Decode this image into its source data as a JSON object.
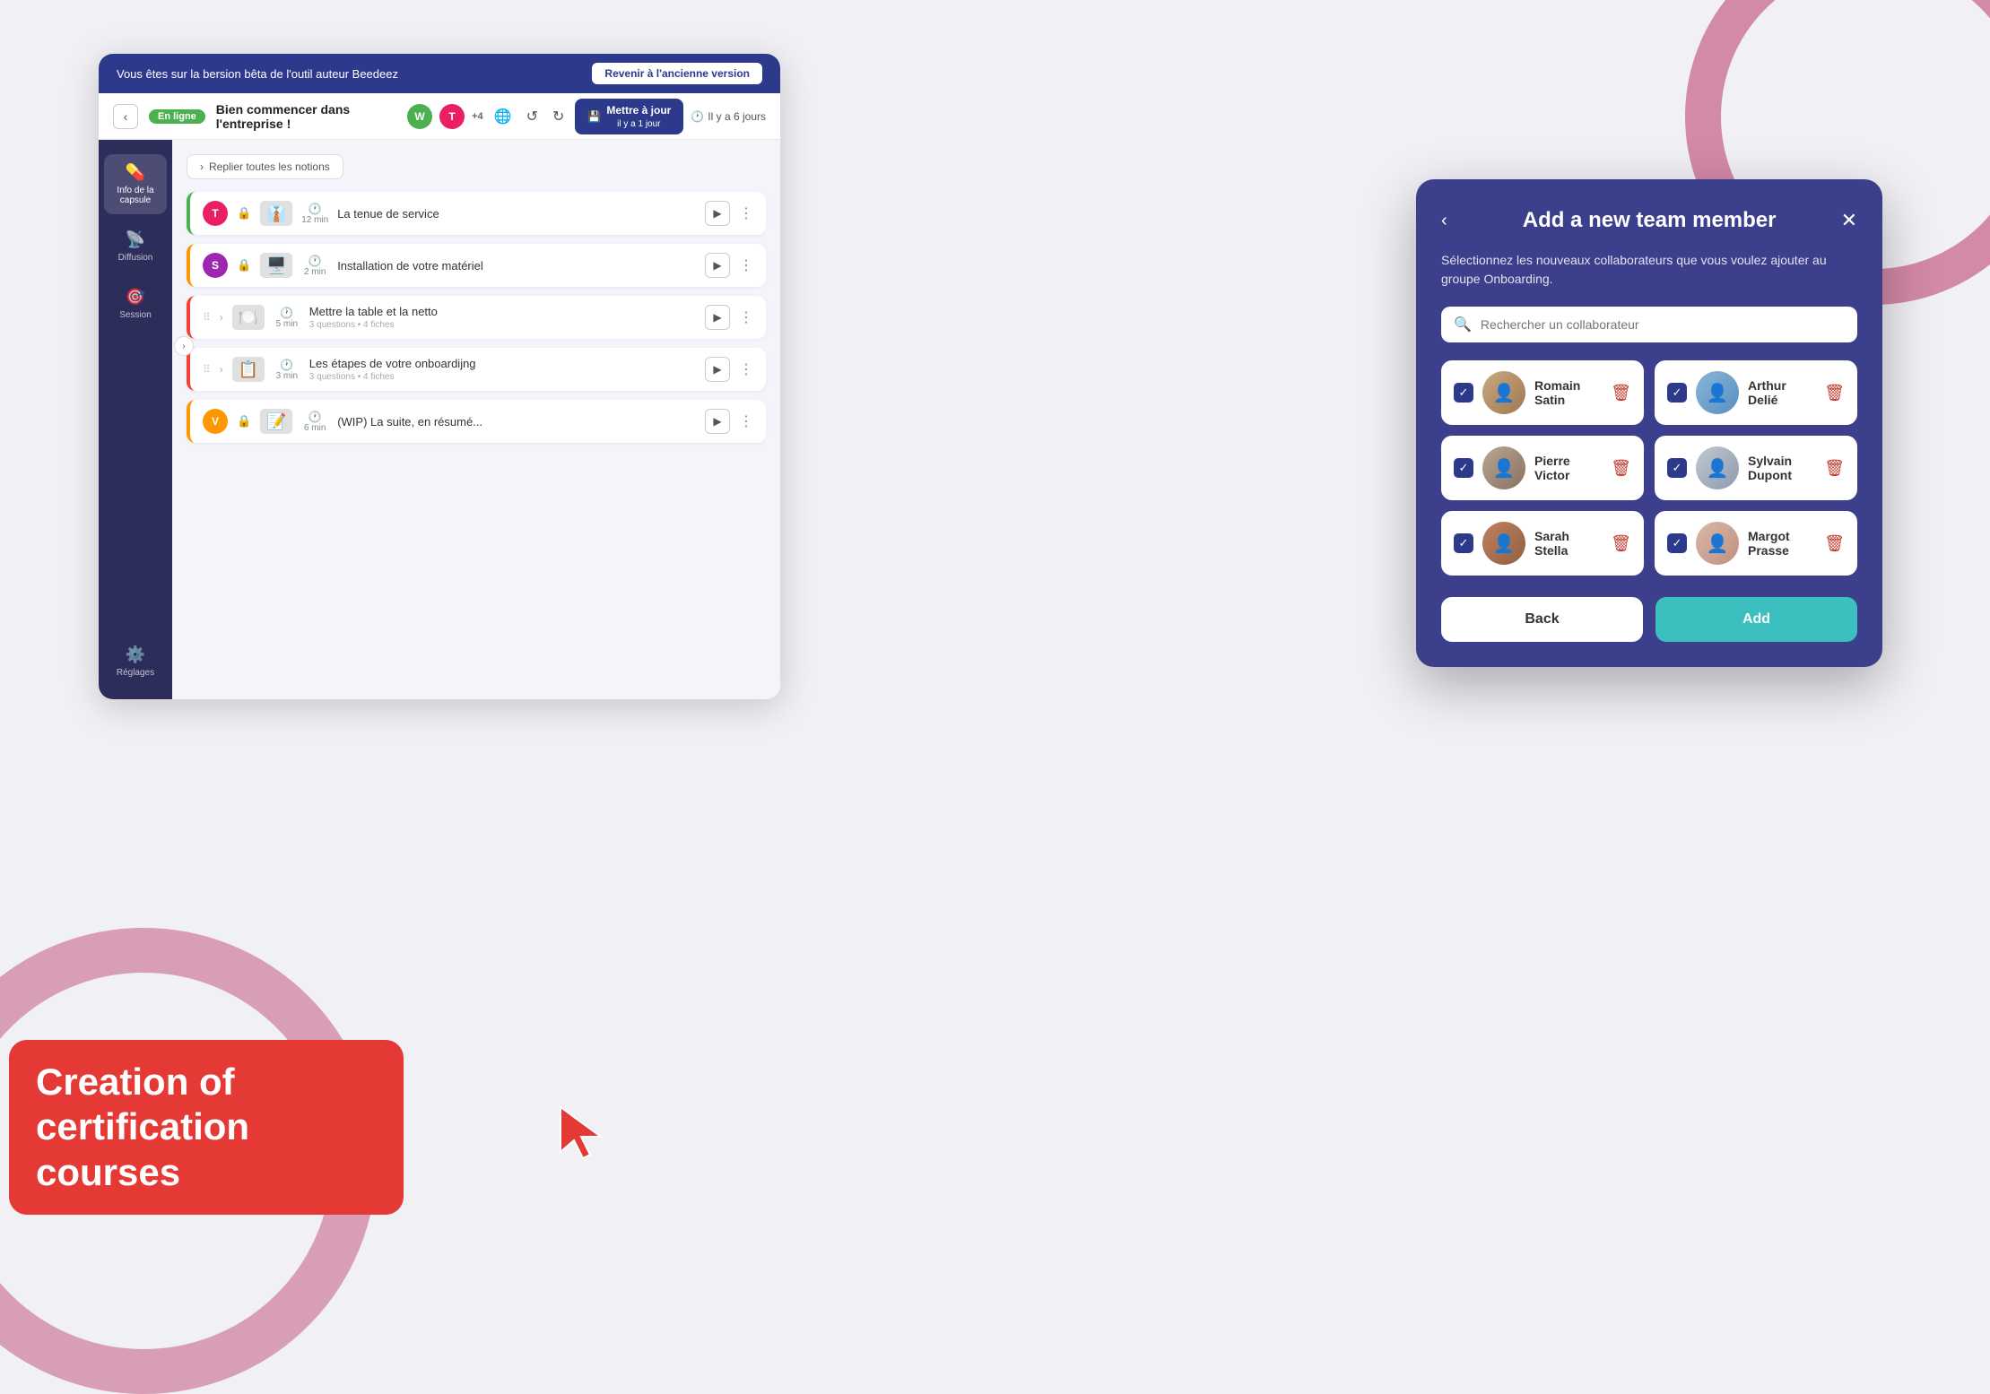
{
  "decorative": {
    "beta_banner": {
      "text": "Vous êtes sur la bersion bêta de l'outil auteur Beedeez",
      "button_label": "Revenir à l'ancienne version"
    }
  },
  "toolbar": {
    "back_label": "‹",
    "status": "En ligne",
    "title": "Bien commencer dans l'entreprise !",
    "avatars": [
      {
        "letter": "W",
        "class": "avatar-w"
      },
      {
        "letter": "T",
        "class": "avatar-t"
      }
    ],
    "count": "+4",
    "save_label": "Mettre à jour",
    "save_sub": "il y a 1 jour",
    "history_label": "Il y a 6 jours"
  },
  "sidebar": {
    "items": [
      {
        "id": "capsule",
        "icon": "💊",
        "label": "Info de la capsule",
        "active": true
      },
      {
        "id": "diffusion",
        "icon": "📡",
        "label": "Diffusion",
        "active": false
      },
      {
        "id": "session",
        "icon": "🎯",
        "label": "Session",
        "active": false
      },
      {
        "id": "reglages",
        "icon": "⚙️",
        "label": "Réglages",
        "active": false
      }
    ]
  },
  "content": {
    "collapse_btn": "Replier toutes les notions",
    "courses": [
      {
        "id": 1,
        "avatar": "T",
        "avatar_class": "av-t",
        "has_lock": true,
        "thumb_emoji": "👔",
        "time": "12 min",
        "title": "La tenue de service",
        "border_class": "green",
        "has_expand": false
      },
      {
        "id": 2,
        "avatar": "S",
        "avatar_class": "av-s",
        "has_lock": true,
        "thumb_emoji": "🖥️",
        "time": "2 min",
        "title": "Installation de votre matériel",
        "border_class": "orange",
        "has_expand": false
      },
      {
        "id": 3,
        "avatar": null,
        "has_lock": false,
        "thumb_emoji": "🍽️",
        "time": "5 min",
        "title": "Mettre la table et la netto",
        "sub": "3 questions • 4 fiches",
        "border_class": "red",
        "has_expand": true
      },
      {
        "id": 4,
        "avatar": null,
        "has_lock": false,
        "thumb_emoji": "📋",
        "time": "3 min",
        "title": "Les étapes de votre onboardijng",
        "sub": "3 questions • 4 fiches",
        "border_class": "red",
        "has_expand": true
      },
      {
        "id": 5,
        "avatar": "V",
        "avatar_class": "av-v",
        "has_lock": true,
        "thumb_emoji": "📝",
        "time": "6 min",
        "title": "(WIP) La suite, en résumé...",
        "border_class": "orange",
        "has_expand": false
      }
    ]
  },
  "red_label": {
    "text": "Creation of certification courses"
  },
  "modal": {
    "title": "Add a new team member",
    "description": "Sélectionnez les nouveaux collaborateurs que vous voulez ajouter au groupe Onboarding.",
    "search_placeholder": "Rechercher un collaborateur",
    "members": [
      {
        "id": 1,
        "name": "Romain\nSatin",
        "name_display": "Romain Satin",
        "face_class": "face-romain",
        "checked": true
      },
      {
        "id": 2,
        "name": "Arthur\nDelié",
        "name_display": "Arthur Delié",
        "face_class": "face-arthur",
        "checked": true
      },
      {
        "id": 3,
        "name": "Pierre\nVictor",
        "name_display": "Pierre Victor",
        "face_class": "face-pierre",
        "checked": true
      },
      {
        "id": 4,
        "name": "Sylvain\nDupont",
        "name_display": "Sylvain Dupont",
        "face_class": "face-sylvain",
        "checked": true
      },
      {
        "id": 5,
        "name": "Sarah\nStella",
        "name_display": "Sarah Stella",
        "face_class": "face-sarah",
        "checked": true
      },
      {
        "id": 6,
        "name": "Margot\nPrasse",
        "name_display": "Margot Prasse",
        "face_class": "face-margot",
        "checked": true
      }
    ],
    "back_label": "Back",
    "add_label": "Add"
  }
}
